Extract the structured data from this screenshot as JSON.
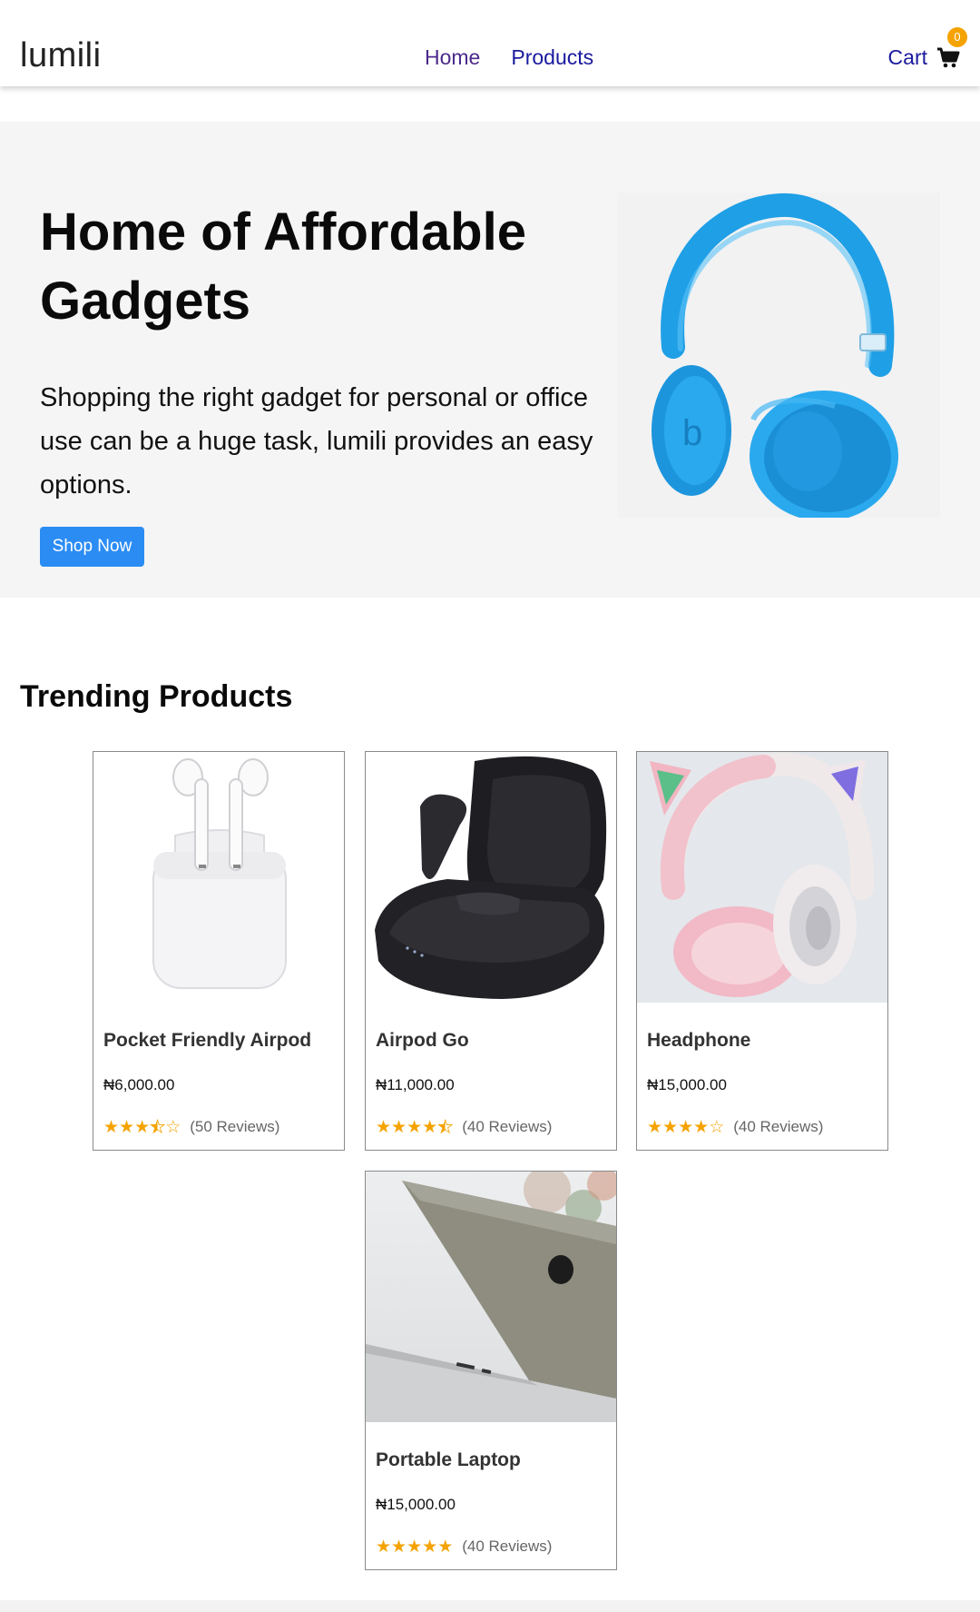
{
  "brand": {
    "name": "lumili"
  },
  "nav": {
    "home": "Home",
    "products": "Products",
    "cart_label": "Cart",
    "cart_count": "0"
  },
  "hero": {
    "title": "Home of Affordable Gadgets",
    "description": "Shopping the right gadget for personal or office use can be a huge task, lumili provides an easy options.",
    "button": "Shop Now"
  },
  "trending": {
    "title": "Trending Products",
    "products": [
      {
        "name": "Pocket Friendly Airpod",
        "price": "₦6,000.00",
        "reviews": "(50 Reviews)",
        "rating": 3.5,
        "image": "airpods-icon"
      },
      {
        "name": "Airpod Go",
        "price": "₦11,000.00",
        "reviews": "(40 Reviews)",
        "rating": 4.5,
        "image": "earbuds-case-icon"
      },
      {
        "name": "Headphone",
        "price": "₦15,000.00",
        "reviews": "(40 Reviews)",
        "rating": 4,
        "image": "cat-headphone-icon"
      },
      {
        "name": "Portable Laptop",
        "price": "₦15,000.00",
        "reviews": "(40 Reviews)",
        "rating": 5,
        "image": "laptop-icon"
      }
    ]
  },
  "colors": {
    "accent": "#2b8cf4",
    "star": "#f5a300",
    "badge": "#f5a300",
    "headphone_blue": "#2aa9ee"
  }
}
